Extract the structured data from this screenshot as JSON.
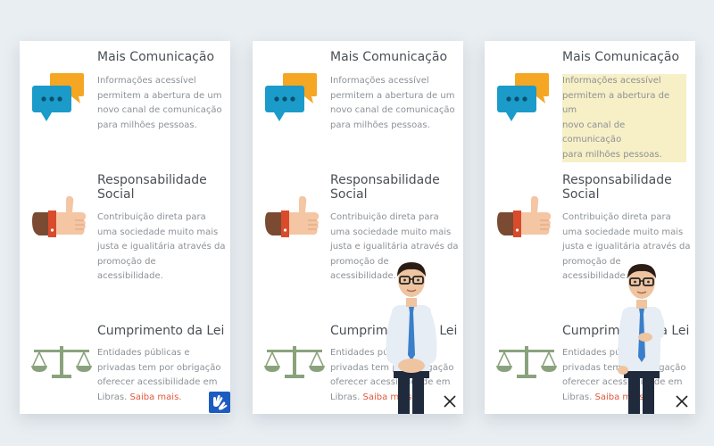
{
  "items": [
    {
      "title": "Mais Comunicação",
      "desc": [
        "Informações acessível",
        "permitem a abertura de um",
        "novo canal de comunicação",
        "para milhões pessoas."
      ]
    },
    {
      "title": [
        "Responsabilidade",
        "Social"
      ],
      "desc": [
        "Contribuição direta para",
        "uma sociedade muito mais",
        "justa e igualitária através da",
        "promoção de",
        "acessibilidade."
      ]
    },
    {
      "title": "Cumprimento da Lei",
      "desc": [
        "Entidades públicas e",
        "privadas tem por obrigação",
        "oferecer acessibilidade em",
        "Libras."
      ],
      "link": "Saiba mais."
    }
  ],
  "icons": {
    "chat": "chat-bubbles-icon",
    "thumbs": "thumbs-up-icon",
    "scale": "scale-justice-icon",
    "accessibility": "sign-language-hands-icon",
    "close": "close-icon"
  },
  "colors": {
    "background": "#e9eef2",
    "panel": "#ffffff",
    "title": "#4a4f55",
    "desc": "#8c9196",
    "link": "#e1573c",
    "highlight": "#f7efc6",
    "chat_blue": "#1a9bc9",
    "chat_orange": "#f5a623",
    "scale_green": "#8aa27c",
    "vlibras_blue": "#1c5bc0"
  }
}
